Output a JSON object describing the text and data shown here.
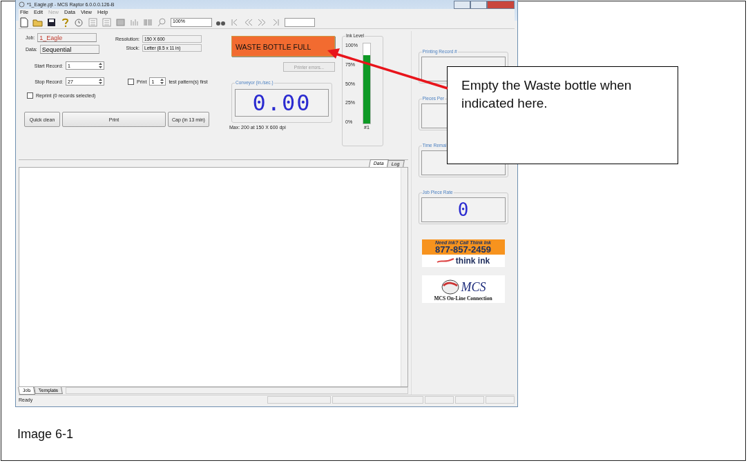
{
  "window": {
    "title": "*1_Eagle.pjt - MCS Raptor 6.0.0.0.126-B"
  },
  "menu": [
    {
      "label": "File",
      "disabled": false
    },
    {
      "label": "Edit",
      "disabled": false
    },
    {
      "label": "New",
      "disabled": true
    },
    {
      "label": "Data",
      "disabled": false
    },
    {
      "label": "View",
      "disabled": false
    },
    {
      "label": "Help",
      "disabled": false
    }
  ],
  "toolbar": {
    "zoom": "100%"
  },
  "job": {
    "job_label": "Job:",
    "job": "1_Eagle",
    "data_label": "Data:",
    "data": "Sequential",
    "resolution_label": "Resolution:",
    "resolution": "150 X 600",
    "stock_label": "Stock:",
    "stock": "Letter (8.5 x 11 in)"
  },
  "records": {
    "start_label": "Start Record:",
    "start": "1",
    "stop_label": "Stop Record:",
    "stop": "27",
    "print_label": "Print",
    "print_checked": false,
    "print_count": "1",
    "print_suffix": "test pattern(s) first",
    "reprint_label": "Reprint (0 records selected)",
    "reprint_checked": false
  },
  "buttons": [
    "Quick clean",
    "Print",
    "Cap (in 13 min)"
  ],
  "alert": "WASTE BOTTLE FULL",
  "printer_errors": {
    "label": "Printer errors...",
    "disabled": true
  },
  "conveyor": {
    "title": "Conveyor (in./sec.)",
    "value": "0.00",
    "note": "Max: 200 at 150 X 600 dpi"
  },
  "ink": {
    "title": "Ink Level",
    "ticks": [
      "100%",
      "75%",
      "50%",
      "25%",
      "0%"
    ],
    "level": 0.85,
    "channel": "#1"
  },
  "top_tabs": [
    {
      "label": "Data",
      "selected": true
    },
    {
      "label": "Log",
      "selected": false
    }
  ],
  "bottom_tabs": [
    {
      "label": "Job",
      "selected": true
    },
    {
      "label": "Template",
      "selected": false
    }
  ],
  "stats": [
    {
      "title": "Printing Record #"
    },
    {
      "title": "Pieces Per"
    },
    {
      "title": "Time Remai"
    },
    {
      "title": "Job Piece Rate",
      "value": "0"
    }
  ],
  "ads": {
    "ink_line": "Need ink? Call Think Ink",
    "phone": "877-857-2459",
    "brand": "think ink",
    "mcs": "MCS",
    "mcs_caption": "MCS On-Line Connection"
  },
  "status_bar": {
    "text": "Ready"
  },
  "callout": {
    "text": "Empty the Waste bottle when indicated here."
  },
  "caption": "Image 6-1"
}
